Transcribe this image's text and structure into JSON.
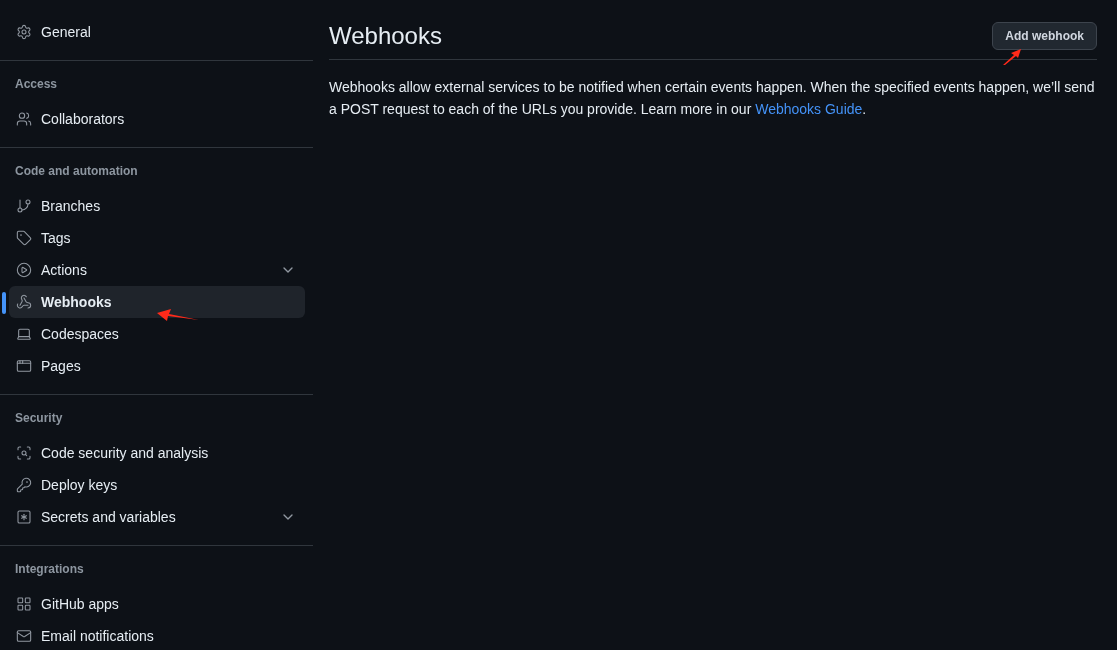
{
  "sidebar": {
    "sections": [
      {
        "items": [
          {
            "label": "General",
            "selected": false,
            "expandable": false
          }
        ]
      },
      {
        "heading": "Access",
        "items": [
          {
            "label": "Collaborators",
            "selected": false,
            "expandable": false
          }
        ]
      },
      {
        "heading": "Code and automation",
        "items": [
          {
            "label": "Branches",
            "selected": false,
            "expandable": false
          },
          {
            "label": "Tags",
            "selected": false,
            "expandable": false
          },
          {
            "label": "Actions",
            "selected": false,
            "expandable": true
          },
          {
            "label": "Webhooks",
            "selected": true,
            "expandable": false
          },
          {
            "label": "Codespaces",
            "selected": false,
            "expandable": false
          },
          {
            "label": "Pages",
            "selected": false,
            "expandable": false
          }
        ]
      },
      {
        "heading": "Security",
        "items": [
          {
            "label": "Code security and analysis",
            "selected": false,
            "expandable": false
          },
          {
            "label": "Deploy keys",
            "selected": false,
            "expandable": false
          },
          {
            "label": "Secrets and variables",
            "selected": false,
            "expandable": true
          }
        ]
      },
      {
        "heading": "Integrations",
        "items": [
          {
            "label": "GitHub apps",
            "selected": false,
            "expandable": false
          },
          {
            "label": "Email notifications",
            "selected": false,
            "expandable": false
          }
        ]
      }
    ]
  },
  "main": {
    "title": "Webhooks",
    "button": "Add webhook",
    "description": {
      "text": "Webhooks allow external services to be notified when certain events happen. When the specified events happen, we’ll send a POST request to each of the URLs you provide. Learn more in our ",
      "link": "Webhooks Guide",
      "after": "."
    }
  }
}
